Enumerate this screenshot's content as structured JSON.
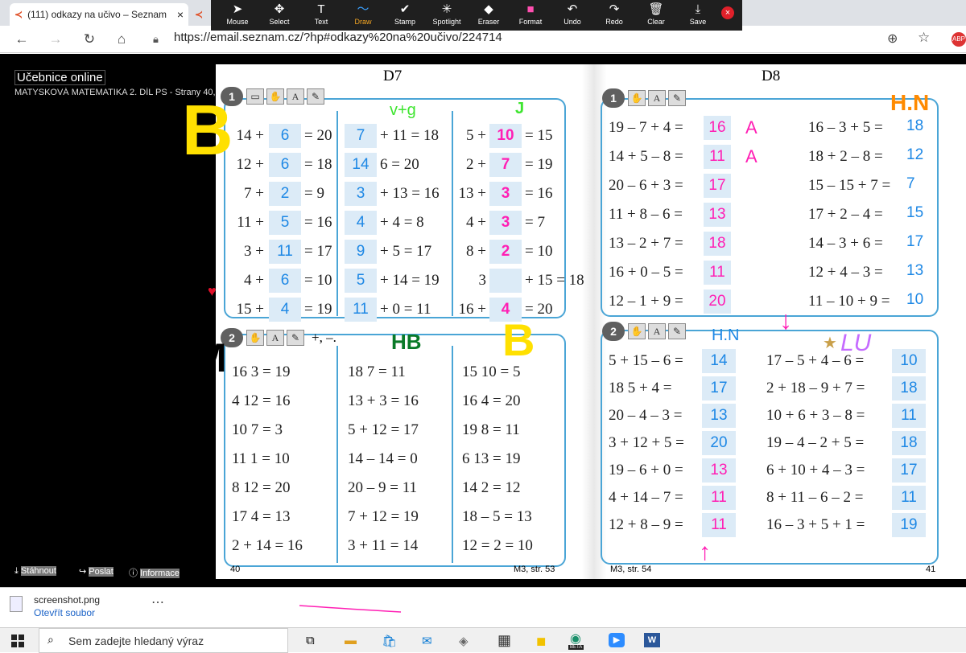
{
  "browser": {
    "tab1_title": "(111) odkazy na učivo – Seznam",
    "tab_close": "×",
    "url": "https://email.seznam.cz/?hp#odkazy%20na%20učivo/224714",
    "back": "←",
    "forward": "→",
    "reload": "↻",
    "home": "⌂"
  },
  "draw_toolbar": [
    {
      "label": "Mouse",
      "icon": "➤"
    },
    {
      "label": "Select",
      "icon": "✥"
    },
    {
      "label": "Text",
      "icon": "T"
    },
    {
      "label": "Draw",
      "icon": "〜"
    },
    {
      "label": "Stamp",
      "icon": "✔"
    },
    {
      "label": "Spotlight",
      "icon": "✳"
    },
    {
      "label": "Eraser",
      "icon": "◆"
    },
    {
      "label": "Format",
      "icon": "■"
    },
    {
      "label": "Undo",
      "icon": "↶"
    },
    {
      "label": "Redo",
      "icon": "↷"
    },
    {
      "label": "Clear",
      "icon": "🗑"
    },
    {
      "label": "Save",
      "icon": "⤓"
    }
  ],
  "viewer": {
    "title": "Učebnice online",
    "subtitle": "MATYSKOVÁ MATEMATIKA 2. DÍL PS - Strany 40, 41",
    "download": "Stáhnout",
    "send": "Poslat",
    "info": "Informace"
  },
  "book": {
    "left_header": "D7",
    "right_header": "D8",
    "left_page_no": "40",
    "right_page_no": "41",
    "ref_left": "M3, str. 53",
    "ref_right": "M3, str. 54",
    "ex1_badge": "1",
    "ex2_badge": "2",
    "ex2_suffix": "+, –.",
    "ex1_left_col1": [
      {
        "a": "14 +",
        "ans": "6",
        "b": "= 20"
      },
      {
        "a": "12 +",
        "ans": "6",
        "b": "= 18"
      },
      {
        "a": "7 +",
        "ans": "2",
        "b": "= 9"
      },
      {
        "a": "11 +",
        "ans": "5",
        "b": "= 16"
      },
      {
        "a": "3 +",
        "ans": "11",
        "b": "= 17"
      },
      {
        "a": "4 +",
        "ans": "6",
        "b": "= 10"
      },
      {
        "a": "15 +",
        "ans": "4",
        "b": "= 19"
      }
    ],
    "ex1_left_col2": [
      {
        "ans": "7",
        "b": "+ 11 = 18"
      },
      {
        "ans": "14",
        "b": "6 = 20"
      },
      {
        "ans": "3",
        "b": "+ 13 = 16"
      },
      {
        "ans": "4",
        "b": "+  4 =  8"
      },
      {
        "ans": "9",
        "b": "+  5 = 17"
      },
      {
        "ans": "5",
        "b": "+ 14 = 19"
      },
      {
        "ans": "11",
        "b": "+  0 = 11"
      }
    ],
    "ex1_left_col3": [
      {
        "a": "5 +",
        "ans": "10",
        "b": "= 15"
      },
      {
        "a": "2 +",
        "ans": "7",
        "b": "= 19"
      },
      {
        "a": "13 +",
        "ans": "3",
        "b": "= 16"
      },
      {
        "a": "4 +",
        "ans": "3",
        "b": "=  7"
      },
      {
        "a": "8 +",
        "ans": "2",
        "b": "= 10"
      },
      {
        "a": "3",
        "ans": "",
        "b": "+ 15 = 18"
      },
      {
        "a": "16 +",
        "ans": "4",
        "b": "= 20"
      }
    ],
    "ex2_left_col1": [
      "16  3 = 19",
      "4  12 = 16",
      "10  7 =  3",
      "11  1 = 10",
      "8  12 = 20",
      "17  4 = 13",
      "2 + 14 = 16"
    ],
    "ex2_left_col2": [
      "18   7 = 11",
      "13 + 3 = 16",
      "5 + 12 = 17",
      "14 – 14 = 0",
      "20 –  9 = 11",
      "7 + 12 = 19",
      "3 + 11 = 14"
    ],
    "ex2_left_col3": [
      "15  10 =  5",
      "16  4 = 20",
      "19  8 = 11",
      "6  13 = 19",
      "14  2 = 12",
      "18 – 5 = 13",
      "12 = 2 = 10"
    ],
    "ex1_right_col1": [
      {
        "expr": "19 – 7 + 4 =",
        "ans": "16",
        "mark": "A"
      },
      {
        "expr": "14 + 5 – 8 =",
        "ans": "11",
        "mark": "A"
      },
      {
        "expr": "20 – 6 + 3 =",
        "ans": "17",
        "mark": ""
      },
      {
        "expr": "11 + 8 – 6 =",
        "ans": "13",
        "mark": ""
      },
      {
        "expr": "13 – 2 + 7 =",
        "ans": "18",
        "mark": ""
      },
      {
        "expr": "16 + 0 – 5 =",
        "ans": "11",
        "mark": ""
      },
      {
        "expr": "12 – 1 + 9 =",
        "ans": "20",
        "mark": ""
      }
    ],
    "ex1_right_col2": [
      {
        "expr": "16 –  3 + 5 =",
        "ans": "18"
      },
      {
        "expr": "18 +  2 – 8 =",
        "ans": "12"
      },
      {
        "expr": "15 – 15 + 7 =",
        "ans": "7"
      },
      {
        "expr": "17 +  2 – 4 =",
        "ans": "15"
      },
      {
        "expr": "14 –  3 + 6 =",
        "ans": "17"
      },
      {
        "expr": "12 +  4 – 3 =",
        "ans": "13"
      },
      {
        "expr": "11 – 10 + 9 =",
        "ans": "10"
      }
    ],
    "ex2_right_col1": [
      {
        "expr": "5 + 15 – 6 =",
        "ans": "14"
      },
      {
        "expr": "18  5 + 4 =",
        "ans": "17"
      },
      {
        "expr": "20 –  4 – 3 =",
        "ans": "13"
      },
      {
        "expr": "3 + 12 + 5 =",
        "ans": "20"
      },
      {
        "expr": "19 –  6 + 0 =",
        "ans": "13"
      },
      {
        "expr": "4 + 14 – 7 =",
        "ans": "11"
      },
      {
        "expr": "12 +  8 – 9 =",
        "ans": "11"
      }
    ],
    "ex2_right_col2": [
      {
        "expr": "17 –  5 + 4 – 6 =",
        "ans": "10"
      },
      {
        "expr": "2 + 18 – 9 + 7 =",
        "ans": "18"
      },
      {
        "expr": "10 +  6 + 3 – 8 =",
        "ans": "11"
      },
      {
        "expr": "19 –  4 – 2 + 5 =",
        "ans": "18"
      },
      {
        "expr": "6 + 10 + 4 – 3 =",
        "ans": "17"
      },
      {
        "expr": "8 + 11 – 6 – 2 =",
        "ans": "11"
      },
      {
        "expr": "16 –  3 + 5 + 1 =",
        "ans": "19"
      }
    ]
  },
  "annotations": {
    "vg": "v+g",
    "j": "J",
    "big_b": "B",
    "hn_orange": "H.N",
    "hn_blue": "H.N",
    "hb": "HB",
    "m": "M",
    "lu": "LU",
    "b_yellow": "B"
  },
  "download_bar": {
    "filename": "screenshot.png",
    "open": "Otevřít soubor",
    "more": "⋯"
  },
  "taskbar": {
    "search_placeholder": "Sem zadejte hledaný výraz",
    "beta": "BETA"
  },
  "colors": {
    "toolbar_bg": "#1f1f1f",
    "answer_blue": "#1e88e5",
    "box_border": "#4aa5d6",
    "ink_pink": "#ff1fb4",
    "ink_green": "#0a7a28",
    "ink_yellow": "#ffe000",
    "ink_orange": "#ff8a00"
  }
}
